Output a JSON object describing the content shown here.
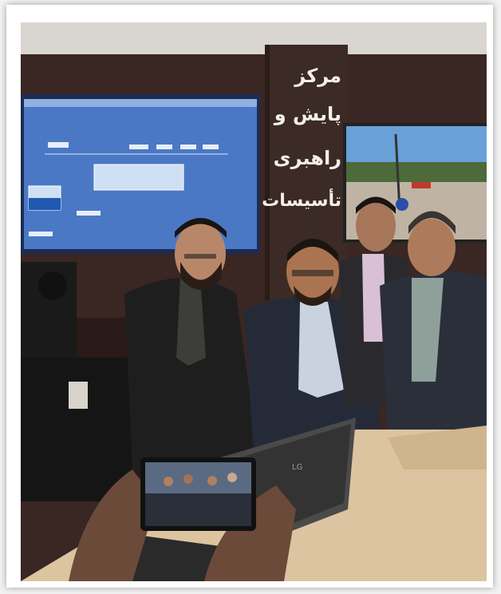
{
  "banner": {
    "lines": [
      "مرکز",
      "پایش و",
      "راهبری",
      "تأسیسات"
    ]
  },
  "laptop": {
    "brand": "LG"
  },
  "colors": {
    "wall_dark": "#3a2622",
    "screen_blue": "#4a78c4",
    "banner_bg": "#3b2a26",
    "desk": "#dcc4a0"
  }
}
